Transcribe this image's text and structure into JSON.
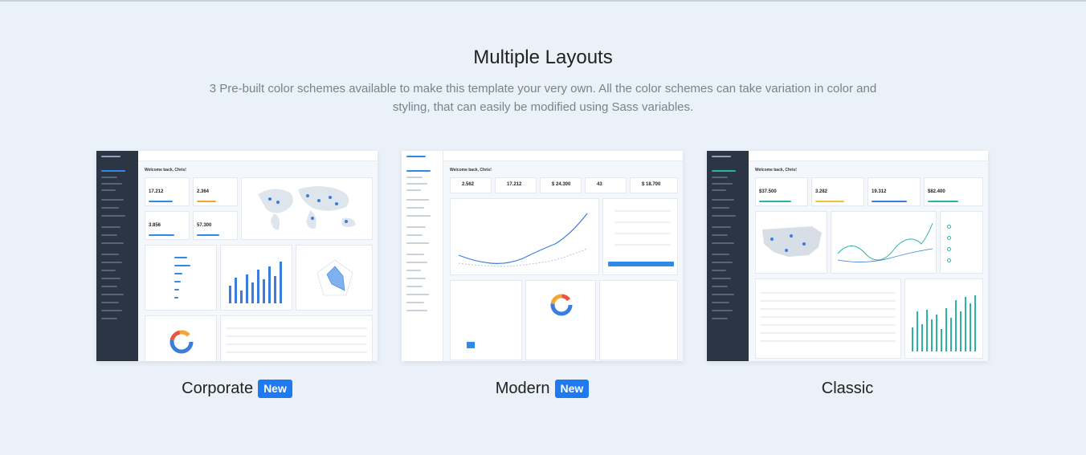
{
  "section": {
    "title": "Multiple Layouts",
    "description": "3 Pre-built color schemes available to make this template your very own. All the color schemes can take variation in color and styling, that can easily be modified using Sass variables."
  },
  "layouts": [
    {
      "label": "Corporate",
      "badge": "New",
      "greeting": "Welcome back, Chris!",
      "stats": [
        "17.212",
        "2.364",
        "3.856",
        "57.300"
      ]
    },
    {
      "label": "Modern",
      "badge": "New",
      "greeting": "Welcome back, Chris!",
      "stats": [
        "2.562",
        "17.212",
        "$ 24.300",
        "43",
        "$ 18.700"
      ]
    },
    {
      "label": "Classic",
      "badge": "",
      "greeting": "Welcome back, Chris!",
      "stats": [
        "$37.500",
        "3.282",
        "19.312",
        "$82.400"
      ]
    }
  ],
  "colors": {
    "accent": "#1f7af0",
    "dark_sidebar": "#2b3543",
    "background": "#eaf1f8"
  }
}
